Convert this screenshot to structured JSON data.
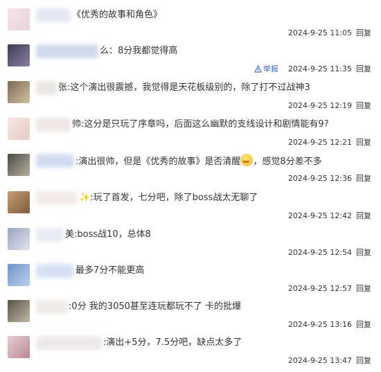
{
  "comments": [
    {
      "prefix": "",
      "text": "《优秀的故事和角色》",
      "time": "2024-9-25 11:05",
      "reply": "回复",
      "avatar_colors": [
        "#f4e4e8",
        "#e9d3d9"
      ],
      "name_color": "#dfe4f0"
    },
    {
      "prefix": "么：",
      "text": "8分我都觉得高",
      "time": "2024-9-25 11:35",
      "reply": "回复",
      "report": "举报",
      "avatar_colors": [
        "#3a3f55",
        "#8d7fa2"
      ],
      "name_color": "#c9d3ea"
    },
    {
      "prefix": "张:",
      "text": "这个演出很震撼，我觉得是天花板级别的，除了打不过战神3",
      "time": "2024-9-25 12:19",
      "reply": "回复",
      "avatar_colors": [
        "#7b6a52",
        "#d2c2a4"
      ],
      "name_color": "#e7e2dc"
    },
    {
      "prefix": "帅:",
      "text": "这分是只玩了序章吗，后面这么幽默的支线设计和剧情能有9?",
      "time": "2024-9-25 12:21",
      "reply": "回复",
      "avatar_colors": [
        "#f6e7e2",
        "#e8cbc4"
      ],
      "name_color": "#ece3e1"
    },
    {
      "prefix": ":",
      "text": "演出很帅，但是《优秀的故事》是否清醒",
      "suffix": "，感觉8分差不多",
      "time": "2024-9-25 12:36",
      "reply": "回复",
      "avatar_colors": [
        "#4c4a45",
        "#b8b0a0"
      ],
      "name_color": "#cbd7ef"
    },
    {
      "prefix": "✨:",
      "text": "玩了首发，七分吧，除了boss战太无聊了",
      "time": "2024-9-25 12:42",
      "reply": "回复",
      "avatar_colors": [
        "#c79c72",
        "#7d5c3e"
      ],
      "name_color": "#f0e8e4"
    },
    {
      "prefix": "美:",
      "text": "boss战10，总体8",
      "time": "2024-9-25 12:54",
      "reply": "回复",
      "avatar_colors": [
        "#9aa4c0",
        "#dfe3ec"
      ],
      "name_color": "#e4e9f3"
    },
    {
      "prefix": "最多",
      "text": "7分不能更高",
      "time": "2024-9-25 12:57",
      "reply": "回复",
      "avatar_colors": [
        "#6e93c8",
        "#bcd0ea"
      ],
      "name_color": "#cfdcf2"
    },
    {
      "prefix": ":",
      "text": "0分 我的3050甚至连玩都玩不了 卡的批爆",
      "time": "2024-9-25 13:16",
      "reply": "回复",
      "avatar_colors": [
        "#5a5248",
        "#c4b7a4"
      ],
      "name_color": "#ece7e4"
    },
    {
      "prefix": ":",
      "text": "演出+5分，7.5分吧，缺点太多了",
      "time": "2024-9-25 13:47",
      "reply": "回复",
      "avatar_colors": [
        "#e9cdd2",
        "#b98894"
      ],
      "name_color": "#ede4e6"
    }
  ]
}
